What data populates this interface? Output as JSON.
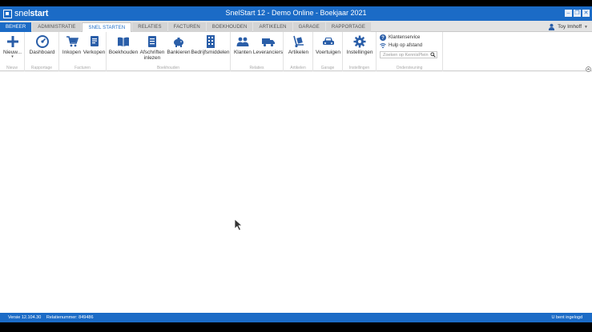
{
  "window": {
    "logo_left": "snel",
    "logo_right": "start",
    "title": "SnelStart 12 - Demo Online - Boekjaar 2021"
  },
  "tabs": [
    {
      "label": "BEHEER"
    },
    {
      "label": "ADMINISTRATIE"
    },
    {
      "label": "SNEL STARTEN"
    },
    {
      "label": "RELATIES"
    },
    {
      "label": "FACTUREN"
    },
    {
      "label": "BOEKHOUDEN"
    },
    {
      "label": "ARTIKELEN"
    },
    {
      "label": "GARAGE"
    },
    {
      "label": "RAPPORTAGE"
    }
  ],
  "active_tab": "SNEL STARTEN",
  "user": {
    "name": "Toy Imhoff"
  },
  "ribbon": {
    "nieuw": {
      "label": "Nieuw...",
      "group": "Nieuw"
    },
    "rapportage": {
      "dashboard": "Dashboard",
      "group": "Rapportage"
    },
    "facturen": {
      "inkopen": "Inkopen",
      "verkopen": "Verkopen",
      "group": "Facturen"
    },
    "boekhouden": {
      "boekhouden": "Boekhouden",
      "afschriften_1": "Afschriften",
      "afschriften_2": "inlezen",
      "bankieren": "Bankieren",
      "bedrijfsmiddelen": "Bedrijfsmiddelen",
      "group": "Boekhouden"
    },
    "relaties": {
      "klanten": "Klanten",
      "leveranciers": "Leveranciers",
      "group": "Relaties"
    },
    "artikelen": {
      "artikelen": "Artikelen",
      "group": "Artikelen"
    },
    "garage": {
      "voertuigen": "Voertuigen",
      "group": "Garage"
    },
    "instellingen": {
      "instellingen": "Instellingen",
      "group": "Instellingen"
    },
    "ondersteuning": {
      "klantenservice": "Klantenservice",
      "hulp": "Hulp op afstand",
      "search_placeholder": "Zoeken op KennisPlein",
      "group": "Ondersteuning"
    }
  },
  "statusbar": {
    "versie": "Versie 12.104.30",
    "relatienummer": "Relatienummer: 849486",
    "login": "U bent ingelogd"
  },
  "colors": {
    "brand": "#1b6bc6",
    "icon": "#2a5ea8"
  },
  "icons": [
    "plus-icon",
    "dashboard-gauge-icon",
    "cart-icon",
    "sales-document-icon",
    "book-icon",
    "bank-statement-icon",
    "piggy-bank-icon",
    "building-icon",
    "people-icon",
    "truck-icon",
    "hand-truck-icon",
    "car-icon",
    "gear-icon",
    "help-icon",
    "wifi-icon",
    "search-icon",
    "user-icon"
  ]
}
